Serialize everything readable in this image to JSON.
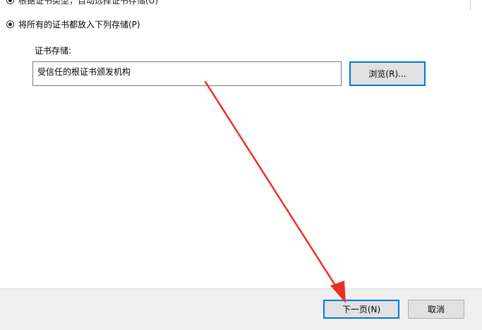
{
  "options": {
    "auto_select_label": "根据证书类型，自动选择证书存储(U)",
    "place_all_label": "将所有的证书都放入下列存储(P)",
    "place_all_selected": true
  },
  "store": {
    "label": "证书存储:",
    "value": "受信任的根证书颁发机构",
    "browse_label": "浏览(R)..."
  },
  "footer": {
    "next_label": "下一页(N)",
    "cancel_label": "取消"
  },
  "colors": {
    "accent": "#0078d7",
    "annotation_arrow": "#e8302a",
    "footer_bg": "#f0f0f0"
  }
}
